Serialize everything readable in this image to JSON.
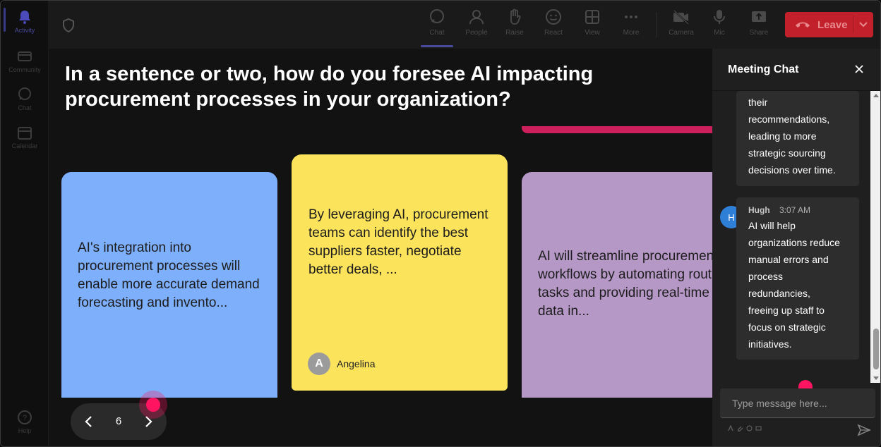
{
  "rail": {
    "items": [
      {
        "label": "Activity",
        "icon": "bell-icon",
        "active": true
      },
      {
        "label": "Community",
        "icon": "community-icon"
      },
      {
        "label": "Chat",
        "icon": "chat-icon"
      },
      {
        "label": "Calendar",
        "icon": "calendar-icon"
      }
    ],
    "help_label": "Help"
  },
  "toolbar": {
    "items": [
      {
        "label": "Chat",
        "icon": "chat-icon",
        "active": true
      },
      {
        "label": "People",
        "icon": "people-icon"
      },
      {
        "label": "Raise",
        "icon": "raise-hand-icon"
      },
      {
        "label": "React",
        "icon": "react-icon"
      },
      {
        "label": "View",
        "icon": "view-grid-icon"
      },
      {
        "label": "More",
        "icon": "more-icon"
      },
      {
        "label": "Camera",
        "icon": "camera-off-icon"
      },
      {
        "label": "Mic",
        "icon": "mic-icon"
      },
      {
        "label": "Share",
        "icon": "share-icon"
      }
    ],
    "leave_label": "Leave",
    "leave_color": "#c2202a"
  },
  "stage": {
    "question": "In a sentence or two, how do you foresee AI impacting procurement processes in your organization?",
    "cards": [
      {
        "text": "AI's integration into procurement processes will enable more accurate demand forecasting and invento...",
        "color": "#7eaffa"
      },
      {
        "text": "By leveraging AI, procurement teams can identify the best suppliers faster, negotiate better deals, ...",
        "color": "#fce35c",
        "author_initial": "A",
        "author_name": "Angelina"
      },
      {
        "text": "AI will streamline procurement workflows by automating routine tasks and providing real-time data in...",
        "color": "#b698c7"
      }
    ],
    "page_number": "6"
  },
  "chat": {
    "title": "Meeting Chat",
    "messages": [
      {
        "lines": [
          "their",
          "recommendations,",
          "leading to more",
          "strategic sourcing",
          "decisions over time."
        ]
      },
      {
        "author": "Hugh",
        "initial": "H",
        "time": "3:07 AM",
        "lines": [
          "AI will help",
          "organizations reduce",
          "manual errors and",
          "process",
          "redundancies,",
          "freeing up staff to",
          "focus on strategic",
          "initiatives."
        ]
      }
    ],
    "input_placeholder": "Type message here..."
  }
}
